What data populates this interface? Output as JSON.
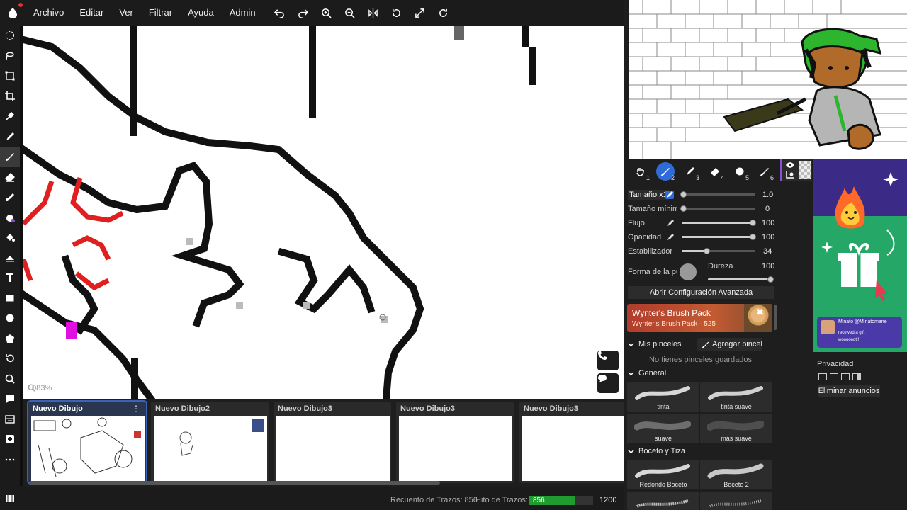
{
  "menubar": {
    "items": [
      "Archivo",
      "Editar",
      "Ver",
      "Filtrar",
      "Ayuda",
      "Admin"
    ]
  },
  "canvas": {
    "zoom": "1083%"
  },
  "drawings": [
    {
      "title": "Nuevo Dibujo",
      "active": true
    },
    {
      "title": "Nuevo Dibujo2",
      "active": false
    },
    {
      "title": "Nuevo Dibujo3",
      "active": false
    },
    {
      "title": "Nuevo Dibujo3",
      "active": false
    },
    {
      "title": "Nuevo Dibujo3",
      "active": false
    }
  ],
  "status": {
    "stroke_count_label": "Recuento de Trazos: 856",
    "stroke_goal_label": "Hito de Trazos:",
    "stroke_value": "856",
    "stroke_goal": "1200",
    "progress_fraction": 0.713
  },
  "brush_tools": [
    "1",
    "2",
    "3",
    "4",
    "5",
    "6"
  ],
  "brush_props": {
    "size_label": "Tamaño x1",
    "size_value": "1.0",
    "min_size_label": "Tamaño mínimo",
    "min_size_value": "0",
    "flow_label": "Flujo",
    "flow_value": "100",
    "opacity_label": "Opacidad",
    "opacity_value": "100",
    "stabilizer_label": "Estabilizador",
    "stabilizer_value": "34",
    "tip_label": "Forma de la punta",
    "hardness_label": "Dureza",
    "hardness_value": "100",
    "advanced_button": "Abrir Configuración Avanzada"
  },
  "promo": {
    "title": "Wynter's Brush Pack",
    "subtitle": "Wynter's Brush Pack · 525"
  },
  "my_brushes": {
    "heading": "Mis pinceles",
    "add_button": "Agregar pincel",
    "empty": "No tienes pinceles guardados"
  },
  "general_section": {
    "heading": "General",
    "brushes": [
      "tinta",
      "tinta suave",
      "suave",
      "más suave"
    ]
  },
  "sketch_section": {
    "heading": "Boceto y Tiza",
    "brushes": [
      "Redondo Boceto",
      "Boceto 2"
    ]
  },
  "ad": {
    "notif_name": "Minato @Minatomane",
    "notif_sub": "received a gift",
    "notif_msg": "woooooot!!"
  },
  "privacy": {
    "label": "Privacidad",
    "remove_ads": "Eliminar anuncios"
  },
  "colors": {
    "accent": "#2f6bd8",
    "progress": "#1f9b2f"
  }
}
